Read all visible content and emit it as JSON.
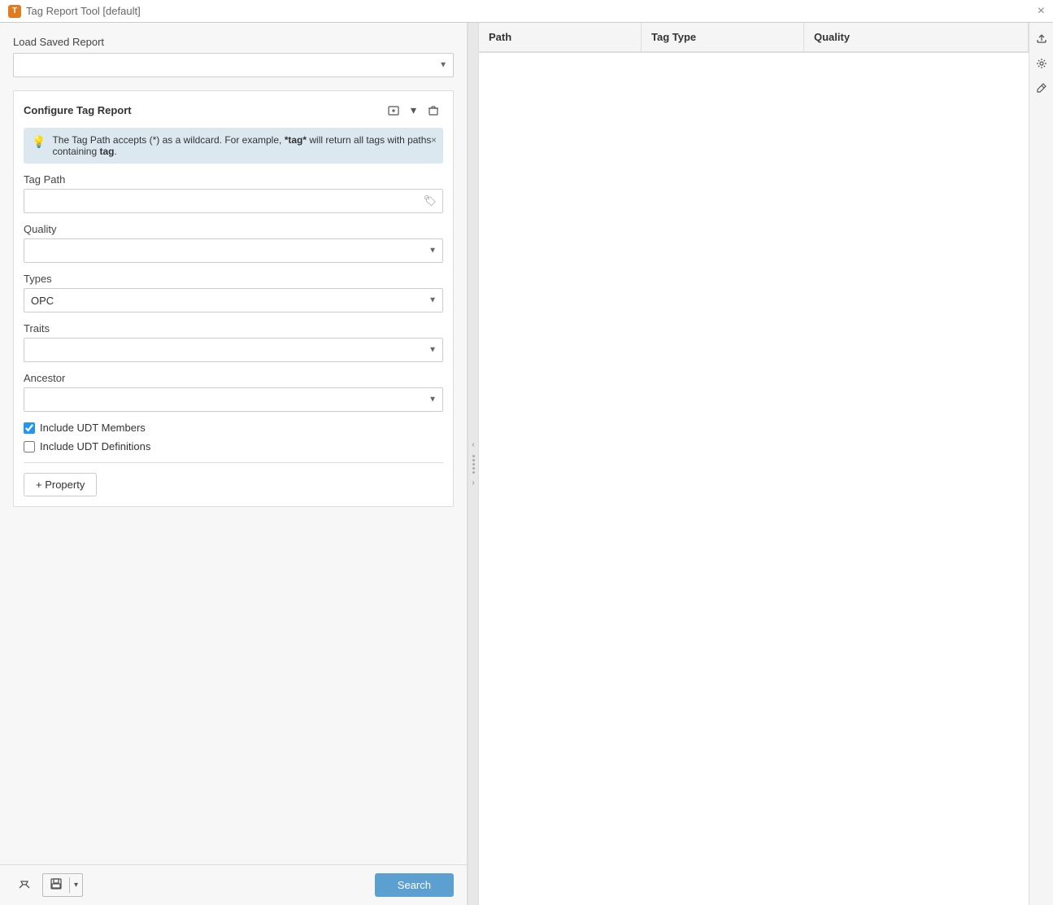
{
  "titleBar": {
    "icon": "T",
    "title": "Tag Report Tool [default]",
    "closeLabel": "×"
  },
  "leftPanel": {
    "loadSection": {
      "label": "Load Saved Report",
      "placeholder": "",
      "options": []
    },
    "configureSection": {
      "title": "Configure Tag Report",
      "infoBanner": {
        "text1": "The Tag Path accepts (*) as a wildcard. For example, ",
        "bold1": "*tag*",
        "text2": " will return all tags with paths containing ",
        "bold2": "tag",
        "text3": "."
      },
      "tagPathLabel": "Tag Path",
      "tagPathPlaceholder": "",
      "qualityLabel": "Quality",
      "qualityOptions": [],
      "typesLabel": "Types",
      "typesValue": "OPC",
      "typesOptions": [
        "OPC"
      ],
      "traitsLabel": "Traits",
      "traitsOptions": [],
      "ancestorLabel": "Ancestor",
      "ancestorOptions": [],
      "includeUDTMembers": {
        "label": "Include UDT Members",
        "checked": true
      },
      "includeUDTDefinitions": {
        "label": "Include UDT Definitions",
        "checked": false
      },
      "propertyBtn": "+ Property"
    }
  },
  "bottomBar": {
    "searchLabel": "Search"
  },
  "rightPanel": {
    "columns": [
      {
        "id": "path",
        "label": "Path"
      },
      {
        "id": "tagType",
        "label": "Tag Type"
      },
      {
        "id": "quality",
        "label": "Quality"
      }
    ],
    "rows": []
  },
  "toolbar": {
    "exportIcon": "⬆",
    "settingsIcon": "⚙",
    "editIcon": "✎"
  },
  "splitter": {
    "collapseLeft": "‹",
    "expandRight": "›"
  }
}
